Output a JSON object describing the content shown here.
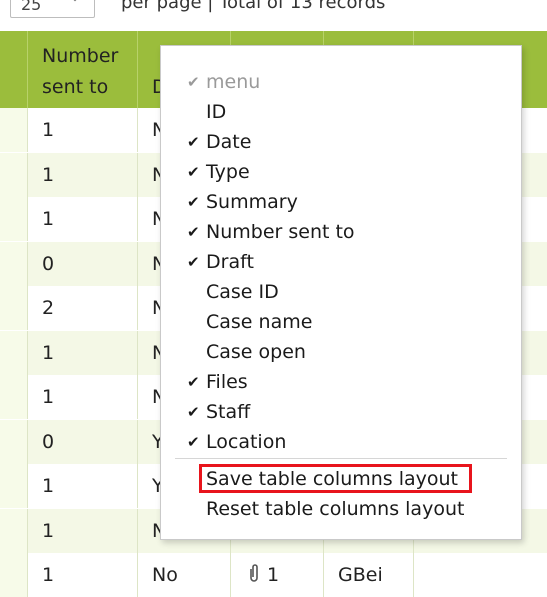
{
  "pager": {
    "per_page_value": "25",
    "summary": "per page | Total of 13 records"
  },
  "table": {
    "headers": [
      {
        "label": ""
      },
      {
        "label": "Number sent to"
      },
      {
        "label": "D"
      },
      {
        "label": ""
      },
      {
        "label": ""
      },
      {
        "label": ""
      }
    ],
    "rows": [
      {
        "number_sent_to": "1",
        "draft": "N"
      },
      {
        "number_sent_to": "1",
        "draft": "N"
      },
      {
        "number_sent_to": "1",
        "draft": "N"
      },
      {
        "number_sent_to": "0",
        "draft": "N"
      },
      {
        "number_sent_to": "2",
        "draft": "N"
      },
      {
        "number_sent_to": "1",
        "draft": "N"
      },
      {
        "number_sent_to": "1",
        "draft": "N"
      },
      {
        "number_sent_to": "0",
        "draft": "Y"
      },
      {
        "number_sent_to": "1",
        "draft": "Y"
      },
      {
        "number_sent_to": "1",
        "draft": "N"
      },
      {
        "number_sent_to": "1",
        "draft": "No",
        "files": "1",
        "staff": "GBei"
      }
    ]
  },
  "menu": {
    "title": "menu",
    "items": [
      {
        "label": "ID",
        "checked": false
      },
      {
        "label": "Date",
        "checked": true
      },
      {
        "label": "Type",
        "checked": true
      },
      {
        "label": "Summary",
        "checked": true
      },
      {
        "label": "Number sent to",
        "checked": true
      },
      {
        "label": "Draft",
        "checked": true
      },
      {
        "label": "Case ID",
        "checked": false
      },
      {
        "label": "Case name",
        "checked": false
      },
      {
        "label": "Case open",
        "checked": false
      },
      {
        "label": "Files",
        "checked": true
      },
      {
        "label": "Staff",
        "checked": true
      },
      {
        "label": "Location",
        "checked": true
      }
    ],
    "save_layout": "Save table columns layout",
    "reset_layout": "Reset table columns layout",
    "check_glyph": "✔",
    "highlight_color": "#e8141c"
  },
  "colors": {
    "header_green": "#9bbd3c",
    "row_stripe": "#f4f8e6"
  }
}
